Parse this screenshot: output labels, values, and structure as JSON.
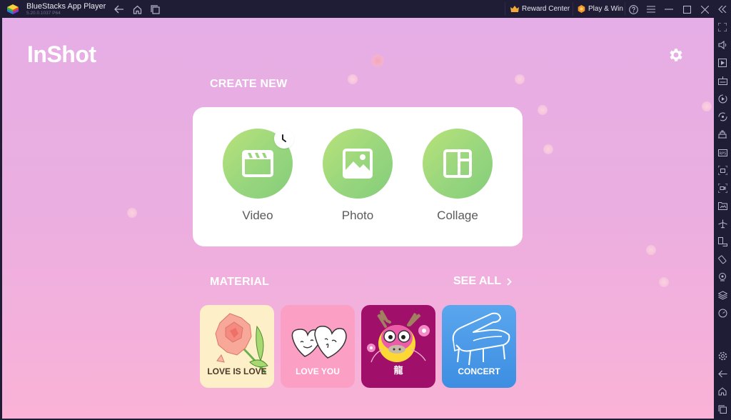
{
  "window": {
    "app_title": "BlueStacks App Player",
    "version": "5.20.0.1037  P64",
    "reward_center_label": "Reward Center",
    "play_win_label": "Play & Win"
  },
  "app": {
    "logo_text": "InShot",
    "create_new_title": "CREATE NEW",
    "create_items": [
      {
        "label": "Video",
        "icon": "clapperboard-icon",
        "badge": "clock-icon"
      },
      {
        "label": "Photo",
        "icon": "image-icon"
      },
      {
        "label": "Collage",
        "icon": "collage-layout-icon"
      }
    ],
    "material_title": "MATERIAL",
    "see_all_label": "SEE ALL",
    "materials": [
      {
        "label": "LOVE IS LOVE",
        "bg": "#fdf0c8",
        "text_color": "#4a3a2a"
      },
      {
        "label": "LOVE YOU",
        "bg": "#fb9fc4",
        "text_color": "#ffffff"
      },
      {
        "label": "龍",
        "bg": "#a0106a",
        "text_color": "#ffffff"
      },
      {
        "label": "CONCERT",
        "bg": "#4a9ae8",
        "text_color": "#ffffff"
      }
    ]
  },
  "sidebar": {
    "items": [
      "fullscreen-icon",
      "volume-icon",
      "media-play-icon",
      "keyboard-controls-icon",
      "macro-record-icon",
      "sync-icon",
      "multi-instance-icon",
      "fps-icon",
      "screenshot-icon",
      "screen-record-icon",
      "media-folder-icon",
      "airplane-mode-icon",
      "rotate-screen-icon",
      "shake-icon",
      "location-icon",
      "layers-icon",
      "performance-icon",
      "settings-icon",
      "back-icon",
      "home-icon",
      "recent-apps-icon"
    ]
  },
  "colors": {
    "accent_green": "#98d67d",
    "titlebar_bg": "#1f1d35",
    "main_bg_top": "#e6aee6",
    "main_bg_bottom": "#fab3d6"
  }
}
